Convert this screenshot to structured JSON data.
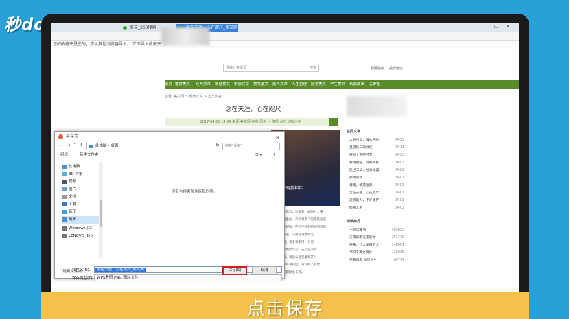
{
  "brand": {
    "logo_text": "秒dong视频"
  },
  "caption": "点击保存",
  "browser": {
    "tabs": [
      {
        "label": "美文_360搜索",
        "active": false
      },
      {
        "label": "念在天涯，心在咫尺_美文网",
        "active": true
      }
    ],
    "bookmark_notice": "您的收藏夹是空的，请从其他浏览器导入。 立即导入收藏夹..."
  },
  "site": {
    "search_placeholder": "请输入关键词",
    "search_button": "搜索",
    "header_links": [
      "我要投稿",
      "投诉建议"
    ],
    "nav": [
      "首页",
      "撒娇美文",
      "经典文章",
      "情感美文",
      "伤感文章",
      "美文散文",
      "感人文章",
      "人生哲理",
      "励志美文",
      "学生美文",
      "长篇故事",
      "活脚社"
    ],
    "breadcrumb": "位置: 美文网 > 经典文章 > 正文内容",
    "title": "念在天涯，心在咫尺",
    "meta": "2017-04-01 14:49  来源:美文网  作者:网络 > 整理  点击:545人次",
    "image_caption": "但你有我相伴",
    "article_lines": [
      "每一寸思念，也面对，如同时，抹",
      "回忆出生命，不如意多少的牵着远遥",
      "开到的可能，在桥手冲到的风团追风",
      "相遇纪录，一路充满着的无",
      "原面用，我手掌事用，为何",
      "一切都如此华美，去了是流的",
      "你不来，我怎么会哭着离开?",
      "来，步月寻归边，日均终了麻歌",
      "的一切都随水长流。"
    ]
  },
  "sidebar": {
    "recommend_title": "空间文章",
    "recommend": [
      {
        "title": "人到中年，懂心回顾",
        "date": "04-13"
      },
      {
        "title": "且思秋日离线红",
        "date": "04-13"
      },
      {
        "title": "邂逅文字的芬芳",
        "date": "04-03"
      },
      {
        "title": "秋雨踏磕，我跟青秋",
        "date": "04-03"
      },
      {
        "title": "乱世浮华，往事如烟",
        "date": "04-02"
      },
      {
        "title": "那时的我",
        "date": "04-01"
      },
      {
        "title": "驿路，情落谁家",
        "date": "04-01"
      },
      {
        "title": "念在天涯，心在咫尺",
        "date": "04-01"
      },
      {
        "title": "流浪的人，不许嫌弃",
        "date": "04-01"
      },
      {
        "title": "倾国人生",
        "date": "04-01"
      }
    ],
    "rank_title": "阅读排行",
    "rank": [
      {
        "title": "一苑读懂书",
        "count": "485859"
      },
      {
        "title": "江南的雨江南的你",
        "count": "251779"
      },
      {
        "title": "庚来，灯火阑珊的人",
        "count": "248001"
      },
      {
        "title": "400字美文摘抄",
        "count": "125015"
      },
      {
        "title": "笑看风雨 淡然人生",
        "count": "89774"
      }
    ]
  },
  "dialog": {
    "title": "另存为",
    "path": [
      "此电脑",
      "桌面"
    ],
    "search_placeholder": "搜索\"桌面\"",
    "organize": "组织",
    "new_folder": "新建文件夹",
    "tree": [
      {
        "label": "此电脑",
        "selected": false
      },
      {
        "label": "3D 对象",
        "selected": false
      },
      {
        "label": "视频",
        "selected": false
      },
      {
        "label": "图片",
        "selected": false
      },
      {
        "label": "文档",
        "selected": false
      },
      {
        "label": "下载",
        "selected": false
      },
      {
        "label": "音乐",
        "selected": false
      },
      {
        "label": "桌面",
        "selected": true
      },
      {
        "label": "Windows (C:)",
        "selected": false
      },
      {
        "label": "LENOVO (D:)",
        "selected": false
      }
    ],
    "empty_message": "没有与搜索条件匹配的项。",
    "filename_label": "文件名(N):",
    "filename_value": "念在天涯，心在咫尺_美文网",
    "filetype_label": "保存类型(T):",
    "filetype_value": "WPS看图 PNG 图片文件",
    "hide_folders": "隐藏文件夹",
    "save_button": "保存(S)",
    "cancel_button": "取消"
  }
}
